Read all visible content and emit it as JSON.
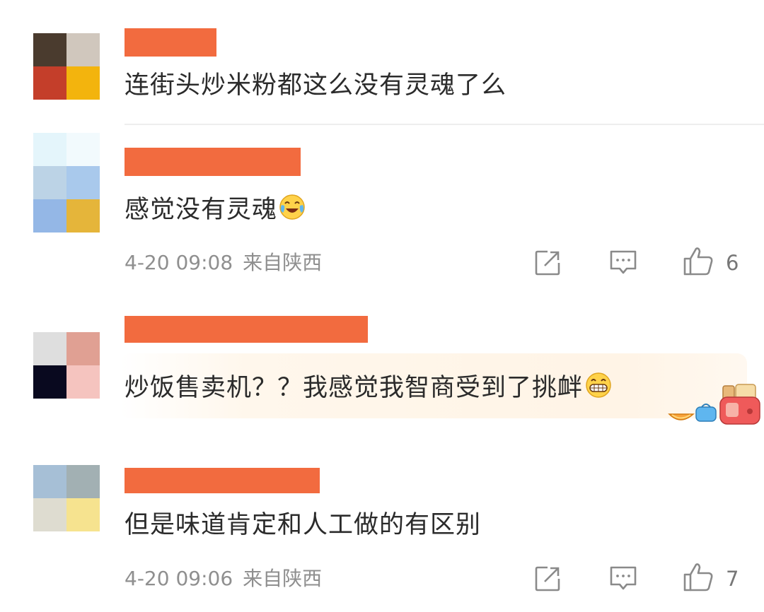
{
  "comments": [
    {
      "text": "连街头炒米粉都这么没有灵魂了么",
      "avatar_colors": [
        "#4a3b2e",
        "#d0c7bd",
        "#c43e2a",
        "#f3b40d"
      ]
    },
    {
      "text": "感觉没有灵魂",
      "emoji": "laughing-crying-emoji",
      "time": "4-20 09:08",
      "source": "来自陕西",
      "likes": "6",
      "avatar_colors": [
        "#e4f5fb",
        "#f2fafd",
        "#bcd3e6",
        "#a9c9ec",
        "#94b7e6",
        "#e5b53a"
      ]
    },
    {
      "text": "炒饭售卖机？？我感觉我智商受到了挑衅",
      "emoji": "grinning-emoji",
      "avatar_colors": [
        "#dedede",
        "#e0a093",
        "#09091f",
        "#f5c4bf"
      ]
    },
    {
      "text": "但是味道肯定和人工做的有区别",
      "time": "4-20 09:06",
      "source": "来自陕西",
      "likes": "7",
      "avatar_colors": [
        "#a6bfd6",
        "#a2b0b3",
        "#dedcd0",
        "#f6e38f"
      ]
    }
  ],
  "colors": {
    "redaction": "#f26b3f",
    "meta_text": "#8f8f8f",
    "icon_stroke": "#8a8a8a"
  },
  "icons": [
    "share-icon",
    "comment-icon",
    "like-icon"
  ]
}
